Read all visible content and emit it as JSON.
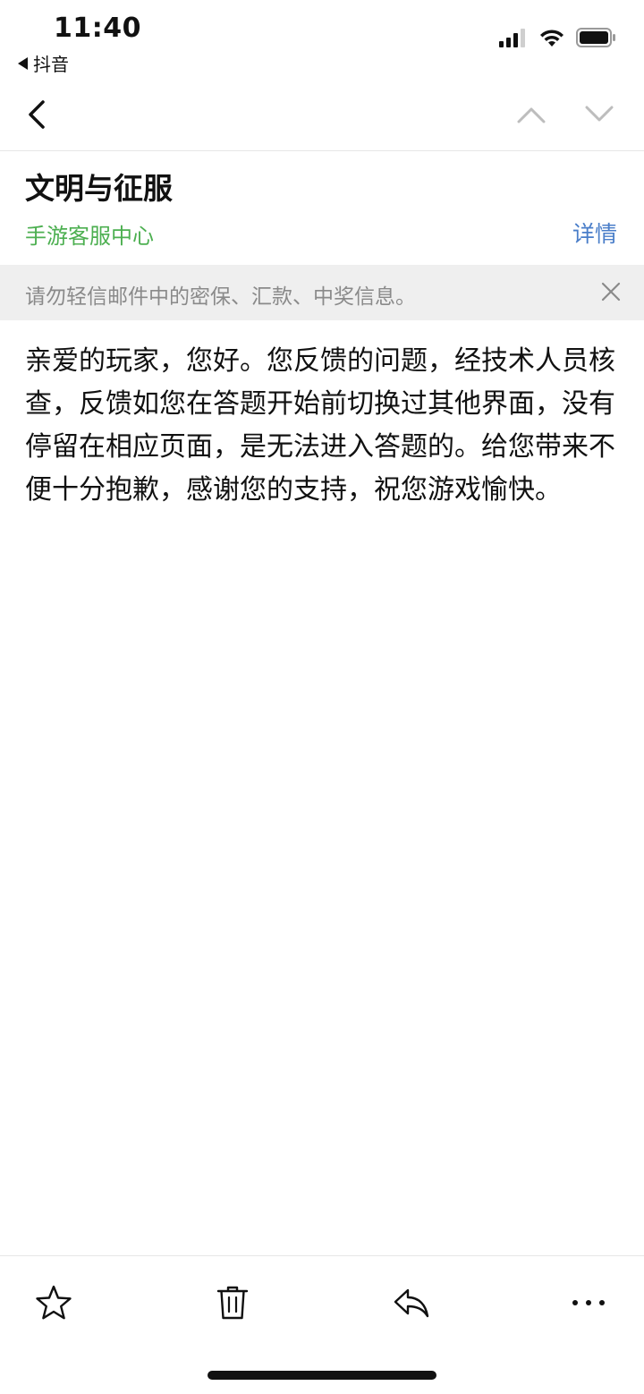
{
  "status_bar": {
    "time": "11:40",
    "back_app": "抖音"
  },
  "nav": {
    "back_icon": "chevron-left-icon",
    "prev_icon": "chevron-up-icon",
    "next_icon": "chevron-down-icon"
  },
  "mail": {
    "subject": "文明与征服",
    "sender": "手游客服中心",
    "details_label": "详情",
    "warning": "请勿轻信邮件中的密保、汇款、中奖信息。",
    "body": "亲爱的玩家，您好。您反馈的问题，经技术人员核查，反馈如您在答题开始前切换过其他界面，没有停留在相应页面，是无法进入答题的。给您带来不便十分抱歉，感谢您的支持，祝您游戏愉快。"
  },
  "toolbar": {
    "items": [
      "star-icon",
      "trash-icon",
      "reply-icon",
      "more-icon"
    ]
  },
  "colors": {
    "sender": "#4caf50",
    "link": "#4a7ec9",
    "banner_bg": "#efefef",
    "banner_text": "#8a8a8a"
  }
}
